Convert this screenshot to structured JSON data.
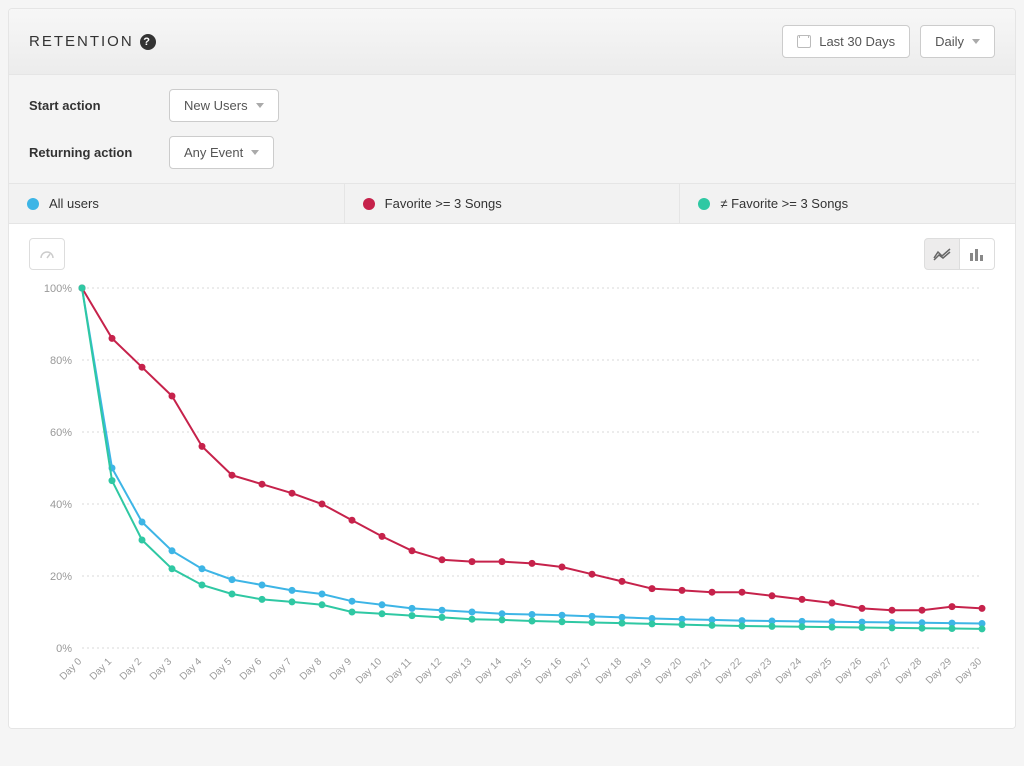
{
  "header": {
    "title": "RETENTION",
    "date_range_label": "Last 30 Days",
    "granularity_label": "Daily"
  },
  "filters": {
    "start_action_label": "Start action",
    "start_action_value": "New Users",
    "returning_action_label": "Returning action",
    "returning_action_value": "Any Event"
  },
  "legend": [
    {
      "label": "All users",
      "color": "#3db5e6"
    },
    {
      "label": "Favorite >= 3 Songs",
      "color": "#c6224b"
    },
    {
      "label": "≠ Favorite >= 3 Songs",
      "color": "#2fc8a3"
    }
  ],
  "chart_data": {
    "type": "line",
    "ylabel": "",
    "xlabel": "",
    "ylim": [
      0,
      100
    ],
    "yticks": [
      0,
      20,
      40,
      60,
      80,
      100
    ],
    "ytick_labels": [
      "0%",
      "20%",
      "40%",
      "60%",
      "80%",
      "100%"
    ],
    "categories": [
      "Day 0",
      "Day 1",
      "Day 2",
      "Day 3",
      "Day 4",
      "Day 5",
      "Day 6",
      "Day 7",
      "Day 8",
      "Day 9",
      "Day 10",
      "Day 11",
      "Day 12",
      "Day 13",
      "Day 14",
      "Day 15",
      "Day 16",
      "Day 17",
      "Day 18",
      "Day 19",
      "Day 20",
      "Day 21",
      "Day 22",
      "Day 23",
      "Day 24",
      "Day 25",
      "Day 26",
      "Day 27",
      "Day 28",
      "Day 29",
      "Day 30"
    ],
    "series": [
      {
        "name": "All users",
        "color": "#3db5e6",
        "values": [
          100,
          50,
          35,
          27,
          22,
          19,
          17.5,
          16,
          15,
          13,
          12,
          11,
          10.5,
          10,
          9.5,
          9.3,
          9.1,
          8.8,
          8.5,
          8.2,
          8,
          7.8,
          7.6,
          7.5,
          7.4,
          7.3,
          7.2,
          7.1,
          7,
          6.9,
          6.8
        ]
      },
      {
        "name": "Favorite >= 3 Songs",
        "color": "#c6224b",
        "values": [
          100,
          86,
          78,
          70,
          56,
          48,
          45.5,
          43,
          40,
          35.5,
          31,
          27,
          24.5,
          24,
          24,
          23.5,
          22.5,
          20.5,
          18.5,
          16.5,
          16,
          15.5,
          15.5,
          14.5,
          13.5,
          12.5,
          11,
          10.5,
          10.5,
          11.5,
          11
        ]
      },
      {
        "name": "≠ Favorite >= 3 Songs",
        "color": "#2fc8a3",
        "values": [
          100,
          46.5,
          30,
          22,
          17.5,
          15,
          13.5,
          12.8,
          12,
          10,
          9.5,
          9,
          8.5,
          8,
          7.8,
          7.5,
          7.3,
          7.1,
          6.9,
          6.7,
          6.5,
          6.3,
          6.1,
          6,
          5.9,
          5.8,
          5.7,
          5.6,
          5.5,
          5.4,
          5.3
        ]
      }
    ]
  }
}
